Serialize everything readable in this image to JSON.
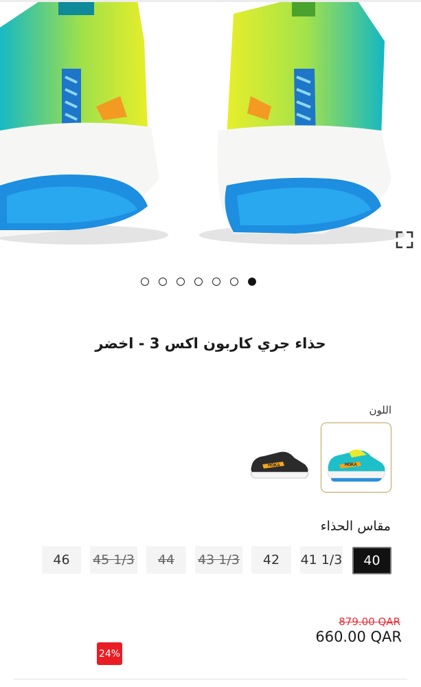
{
  "gallery": {
    "image_name": "shoe-rear-view-image",
    "slide_count": 7,
    "active_slide": 7,
    "expand_icon": "expand-icon"
  },
  "product": {
    "title": "حذاء جري كاربون اكس 3 - اخضر"
  },
  "color": {
    "label": "اللون",
    "options": [
      {
        "name": "green-blue-variant",
        "selected": true,
        "colors": [
          "#1dbfc8",
          "#e8ea2b"
        ]
      },
      {
        "name": "black-white-variant",
        "selected": false,
        "colors": [
          "#2b2b2b",
          "#f5a623"
        ]
      }
    ]
  },
  "size": {
    "label": "مقاس الحذاء",
    "options": [
      {
        "label": "40",
        "state": "selected"
      },
      {
        "label": "41 1/3",
        "state": "available"
      },
      {
        "label": "42",
        "state": "available"
      },
      {
        "label": "43 1/3",
        "state": "unavailable"
      },
      {
        "label": "44",
        "state": "unavailable"
      },
      {
        "label": "45 1/3",
        "state": "unavailable"
      },
      {
        "label": "46",
        "state": "available"
      }
    ]
  },
  "pricing": {
    "old_price": "879.00 QAR",
    "price": "660.00 QAR",
    "discount": "24%"
  },
  "colors": {
    "sale_red": "#ea1c24",
    "selected_border": "#b9a35a"
  }
}
